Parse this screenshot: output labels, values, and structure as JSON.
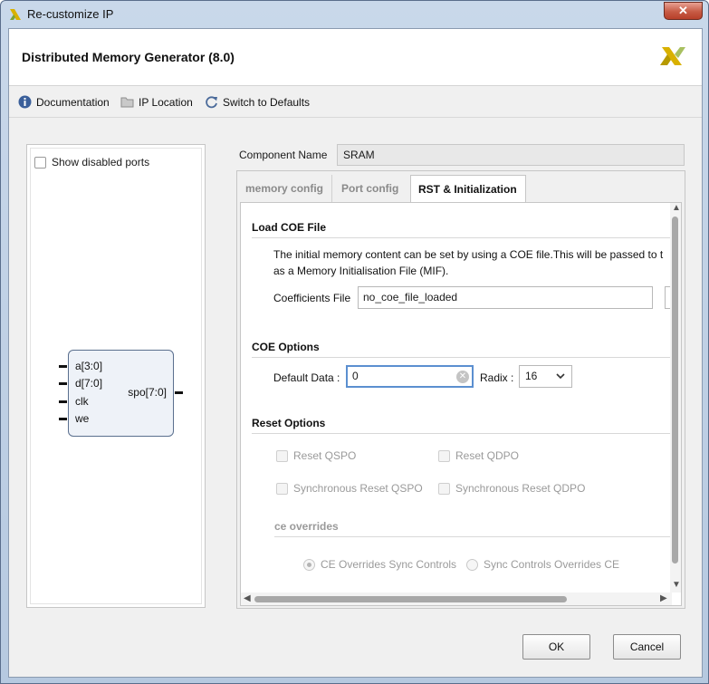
{
  "window": {
    "title": "Re-customize IP",
    "close_glyph": "✕"
  },
  "header": {
    "title": "Distributed Memory Generator (8.0)",
    "logo": "xilinx-logo"
  },
  "toolbar": {
    "documentation": "Documentation",
    "ip_location": "IP Location",
    "switch_defaults": "Switch to Defaults"
  },
  "left_panel": {
    "show_disabled_ports": "Show disabled ports",
    "block": {
      "inputs": [
        "a[3:0]",
        "d[7:0]",
        "clk",
        "we"
      ],
      "output": "spo[7:0]"
    }
  },
  "component": {
    "label": "Component Name",
    "value": "SRAM"
  },
  "tabs": [
    {
      "label": "memory config",
      "active": false
    },
    {
      "label": "Port config",
      "active": false
    },
    {
      "label": "RST & Initialization",
      "active": true
    }
  ],
  "load_coe": {
    "title": "Load COE File",
    "desc_line1": "The initial memory content can be set by using a COE file.This will be passed to t",
    "desc_line2": "as a Memory Initialisation File (MIF).",
    "coeff_label": "Coefficients File",
    "coeff_value": "no_coe_file_loaded"
  },
  "coe_options": {
    "title": "COE Options",
    "default_data_label": "Default Data :",
    "default_data_value": "0",
    "radix_label": "Radix :",
    "radix_value": "16"
  },
  "reset_options": {
    "title": "Reset Options",
    "reset_qspo": "Reset QSPO",
    "reset_qdpo": "Reset QDPO",
    "sync_reset_qspo": "Synchronous Reset QSPO",
    "sync_reset_qdpo": "Synchronous Reset QDPO",
    "ce_overrides_title": "ce overrides",
    "ce_overrides_sync": "CE Overrides Sync Controls",
    "sync_overrides_ce": "Sync Controls Overrides CE"
  },
  "buttons": {
    "ok": "OK",
    "cancel": "Cancel"
  }
}
